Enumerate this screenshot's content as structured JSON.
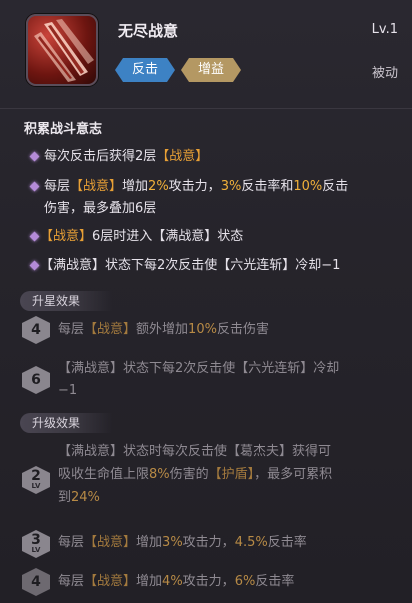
{
  "skill": {
    "name": "无尽战意",
    "level": "Lv.1",
    "tags": [
      "反击",
      "增益"
    ],
    "type": "被动",
    "icon": "crimson-slashes-icon"
  },
  "section_title": "积累战斗意志",
  "effects": [
    [
      "每次反击后获得2层",
      "【战意】"
    ],
    [
      "每层",
      "【战意】",
      "增加",
      "2%",
      "攻击力，",
      "3%",
      "反击率和",
      "10%",
      "反击"
    ],
    [
      "伤害，最多叠加6层"
    ],
    [
      "【战意】",
      "6层时进入【满战意】状态"
    ],
    [
      "【满战意】状态下每2次反击使【六光连斩】冷却−1"
    ]
  ],
  "star_header": "升星效果",
  "star_effects": [
    {
      "badge": "4",
      "parts": [
        "每层",
        "【战意】",
        "额外增加",
        "10%",
        "反击伤害"
      ]
    },
    {
      "badge": "6",
      "parts": [
        "【满战意】状态下每2次反击使【六光连斩】冷却"
      ],
      "cont": "−1"
    }
  ],
  "upgrade_header": "升级效果",
  "upgrade_effects": [
    {
      "badge": "2",
      "badge_sub": "LV",
      "lines": [
        [
          "【满战意】状态时每次反击使【葛杰夫】获得可"
        ],
        [
          "吸收生命值上限",
          "8%",
          "伤害的",
          "【护盾】",
          "，最多可累积"
        ],
        [
          "到",
          "24%"
        ]
      ]
    },
    {
      "badge": "3",
      "badge_sub": "LV",
      "parts": [
        "每层",
        "【战意】",
        "增加",
        "3%",
        "攻击力，",
        "4.5%",
        "反击率"
      ]
    },
    {
      "badge": "4",
      "badge_sub": "",
      "parts": [
        "每层",
        "【战意】",
        "增加",
        "4%",
        "攻击力，",
        "6%",
        "反击率"
      ]
    }
  ],
  "colors": {
    "highlight": "#e8a036",
    "bullet": "#b48bd8",
    "counter_tag": "#3d82c4",
    "buff_tag": "#b49863"
  }
}
